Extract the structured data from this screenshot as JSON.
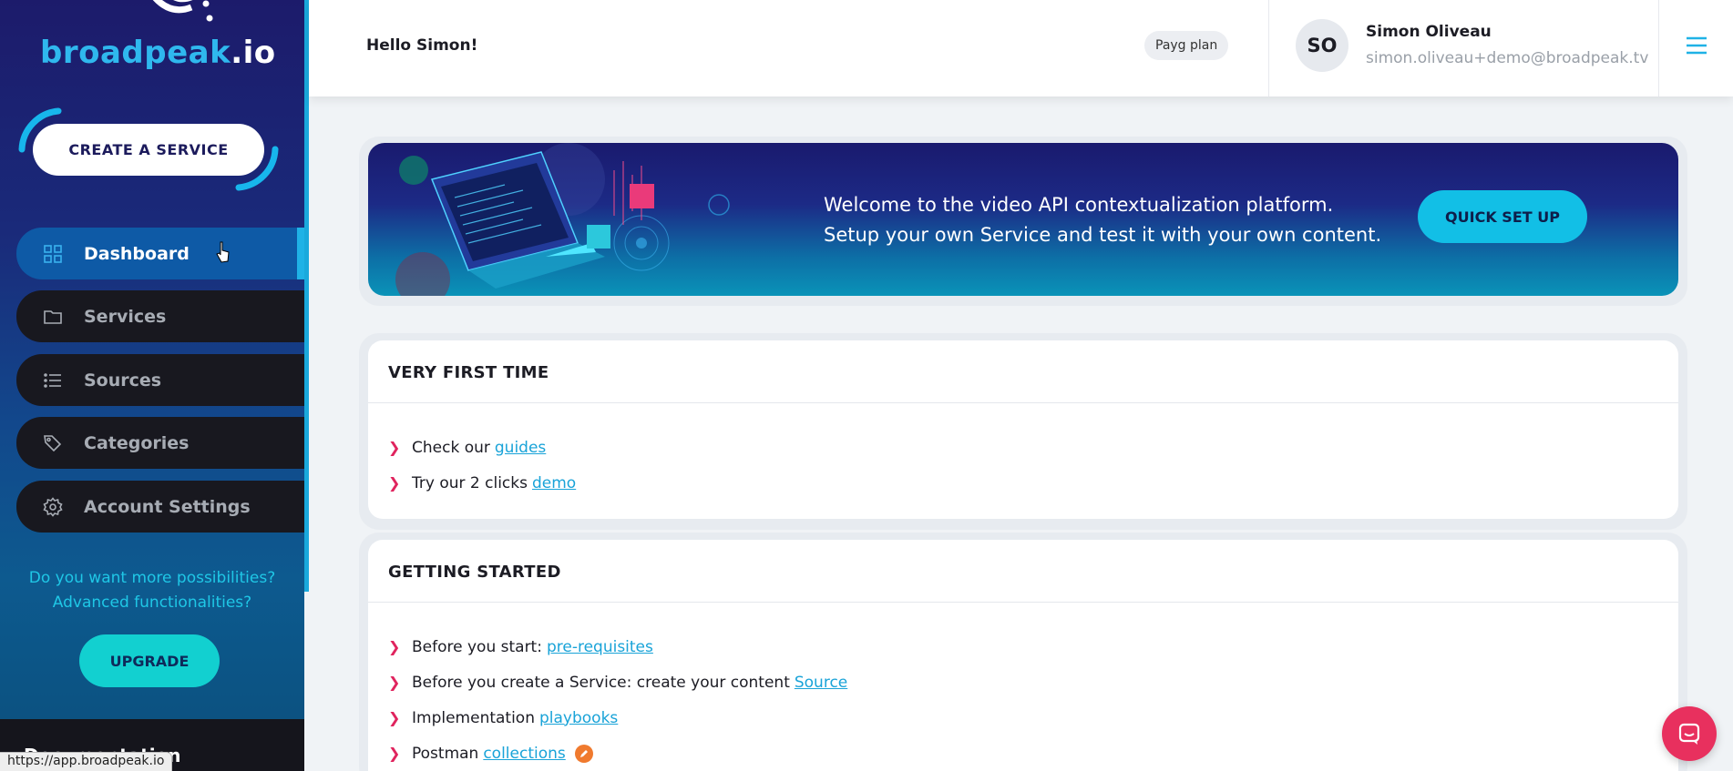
{
  "sidebar": {
    "logo": {
      "main": "broadpeak",
      "suffix": ".io"
    },
    "create_label": "CREATE A SERVICE",
    "items": [
      {
        "label": "Dashboard",
        "icon": "grid-icon",
        "active": true
      },
      {
        "label": "Services",
        "icon": "folder-icon",
        "active": false
      },
      {
        "label": "Sources",
        "icon": "list-icon",
        "active": false
      },
      {
        "label": "Categories",
        "icon": "tags-icon",
        "active": false
      },
      {
        "label": "Account Settings",
        "icon": "gear-icon",
        "active": false
      }
    ],
    "upsell_line1": "Do you want more possibilities?",
    "upsell_line2": "Advanced functionalities?",
    "upgrade_label": "UPGRADE",
    "bottom_text": "Documentation"
  },
  "status_url": "https://app.broadpeak.io",
  "header": {
    "greeting": "Hello Simon!",
    "plan": "Payg plan",
    "avatar_initials": "SO",
    "user_name": "Simon Oliveau",
    "user_email": "simon.oliveau+demo@broadpeak.tv"
  },
  "banner": {
    "line1": "Welcome to the video API contextualization platform.",
    "line2": "Setup your own Service and test it with your own content.",
    "button_label": "QUICK SET UP"
  },
  "first_time": {
    "title": "VERY FIRST TIME",
    "items": [
      {
        "text": "Check our",
        "link": "guides"
      },
      {
        "text": "Try our 2 clicks",
        "link": "demo"
      }
    ]
  },
  "getting_started": {
    "title": "GETTING STARTED",
    "items": [
      {
        "text": "Before you start:",
        "link": "pre-requisites"
      },
      {
        "text": "Before you create a Service: create your content",
        "link": "Source"
      },
      {
        "text": "Implementation",
        "link": "playbooks"
      },
      {
        "text": "Postman",
        "link": "collections"
      }
    ]
  },
  "colors": {
    "accent": "#19a3d8",
    "chevron": "#e0245e",
    "chat": "#e8305e",
    "upgrade": "#12d0d0"
  }
}
